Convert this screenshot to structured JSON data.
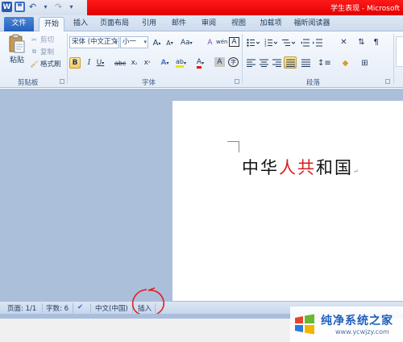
{
  "titlebar": {
    "title": "学生表现 - Microsoft"
  },
  "tabs": [
    "文件",
    "开始",
    "插入",
    "页面布局",
    "引用",
    "邮件",
    "审阅",
    "视图",
    "加载项",
    "福昕阅读器"
  ],
  "clipboard": {
    "paste": "粘贴",
    "cut": "剪切",
    "copy": "复制",
    "format_painter": "格式刷",
    "group_label": "剪贴板"
  },
  "font": {
    "font_name": "宋体 (中文正文",
    "font_size": "小一",
    "grow": "A",
    "shrink": "A",
    "case": "Aa",
    "clear_format": "A",
    "phonetic": "wén",
    "char_border": "A",
    "bold": "B",
    "italic": "I",
    "underline": "U",
    "strikethrough": "abc",
    "subscript": "x",
    "superscript": "x",
    "text_effects": "A",
    "highlight": "ab",
    "font_color": "A",
    "char_shading": "A",
    "enclose": "字",
    "group_label": "字体"
  },
  "paragraph": {
    "group_label": "段落"
  },
  "document": {
    "text_part1": "中华",
    "text_part2": "人共",
    "text_part3": "和国",
    "paragraph_mark": "↵"
  },
  "statusbar": {
    "page": "页面: 1/1",
    "words": "字数: 6",
    "language": "中文(中国)",
    "mode": "插入"
  },
  "watermark": {
    "title": "纯净系统之家",
    "url": "www.ycwjzy.com"
  },
  "colors": {
    "title_red": "#e00000",
    "accent_blue": "#2560b9",
    "highlight_red": "#d42020"
  }
}
